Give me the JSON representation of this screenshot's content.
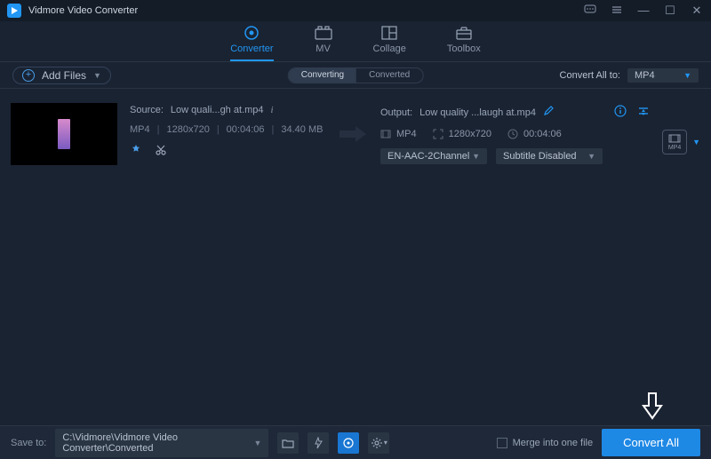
{
  "app": {
    "title": "Vidmore Video Converter"
  },
  "tabs": {
    "converter": "Converter",
    "mv": "MV",
    "collage": "Collage",
    "toolbox": "Toolbox"
  },
  "toolbar": {
    "add_files": "Add Files",
    "sub_converting": "Converting",
    "sub_converted": "Converted",
    "convert_all_to_label": "Convert All to:",
    "convert_all_to_value": "MP4"
  },
  "item": {
    "source_label": "Source:",
    "source_name": "Low quali...gh at.mp4",
    "format": "MP4",
    "resolution": "1280x720",
    "duration": "00:04:06",
    "size": "34.40 MB",
    "output_label": "Output:",
    "output_name": "Low quality ...laugh at.mp4",
    "out_format": "MP4",
    "out_resolution": "1280x720",
    "out_duration": "00:04:06",
    "audio_track": "EN-AAC-2Channel",
    "subtitle": "Subtitle Disabled"
  },
  "footer": {
    "save_to_label": "Save to:",
    "save_path": "C:\\Vidmore\\Vidmore Video Converter\\Converted",
    "merge_label": "Merge into one file",
    "convert_all": "Convert All"
  }
}
